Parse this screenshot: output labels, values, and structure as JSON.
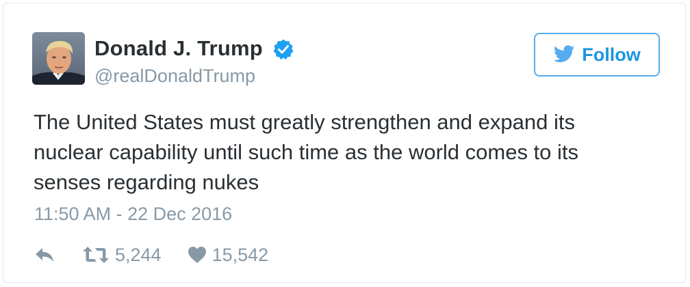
{
  "user": {
    "display_name": "Donald J. Trump",
    "handle": "@realDonaldTrump",
    "verified_icon": "verified-badge-icon"
  },
  "follow_button": {
    "label": "Follow",
    "icon": "twitter-bird-icon"
  },
  "tweet": {
    "text": "The United States must greatly strengthen and expand its nuclear capability until such time as the world comes to its senses regarding nukes",
    "timestamp": "11:50 AM - 22 Dec 2016"
  },
  "actions": {
    "reply_icon": "reply-icon",
    "retweet_icon": "retweet-icon",
    "retweet_count": "5,244",
    "like_icon": "heart-icon",
    "like_count": "15,542"
  },
  "colors": {
    "accent": "#1b95e0",
    "border_accent": "#55acee",
    "text": "#292f33",
    "muted": "#8899a6",
    "card_border": "#e1e8ed"
  }
}
